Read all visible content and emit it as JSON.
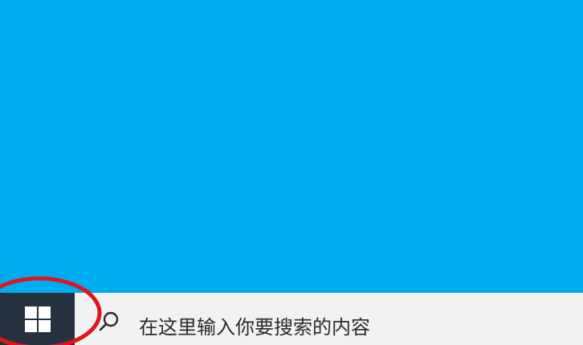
{
  "colors": {
    "desktop_background": "#00acf0",
    "taskbar_background": "#f2f2f2",
    "start_button_background": "#25313f",
    "windows_logo": "#ffffff",
    "search_text": "#2a2a2a",
    "search_icon": "#2a2a2a",
    "annotation_ring": "#e0141e"
  },
  "taskbar": {
    "start_icon": "windows-logo-icon",
    "search": {
      "icon": "search-icon",
      "placeholder": "在这里输入你要搜索的内容"
    }
  },
  "annotation": {
    "shape": "ellipse",
    "target": "start-button"
  }
}
